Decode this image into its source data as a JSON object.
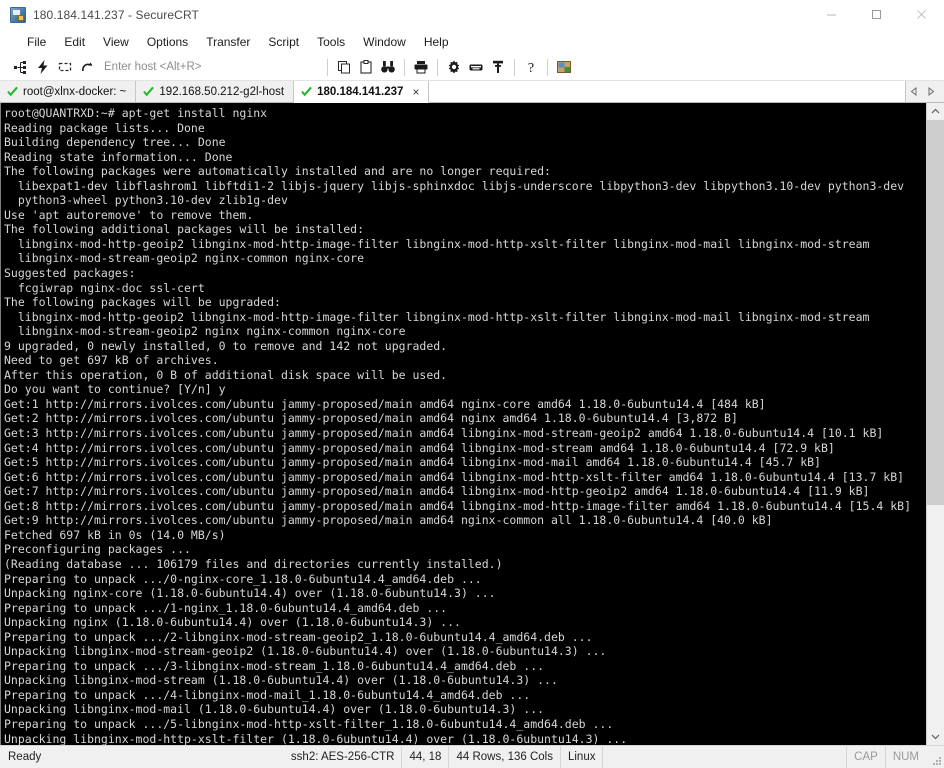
{
  "window": {
    "title": "180.184.141.237 - SecureCRT",
    "app_icon": "securecrt-icon",
    "minimize_label": "Minimize",
    "maximize_label": "Maximize",
    "close_label": "Close"
  },
  "menubar": {
    "items": [
      {
        "label": "File"
      },
      {
        "label": "Edit"
      },
      {
        "label": "View"
      },
      {
        "label": "Options"
      },
      {
        "label": "Transfer"
      },
      {
        "label": "Script"
      },
      {
        "label": "Tools"
      },
      {
        "label": "Window"
      },
      {
        "label": "Help"
      }
    ]
  },
  "toolbar": {
    "host_placeholder": "Enter host <Alt+R>",
    "host_value": "",
    "icons": [
      {
        "name": "new-session-icon",
        "title": "New Session"
      },
      {
        "name": "quick-connect-icon",
        "title": "Quick Connect"
      },
      {
        "name": "reconnect-icon",
        "title": "Reconnect"
      },
      {
        "name": "disconnect-icon",
        "title": "Disconnect"
      },
      {
        "name": "copy-icon",
        "title": "Copy"
      },
      {
        "name": "paste-icon",
        "title": "Paste"
      },
      {
        "name": "find-icon",
        "title": "Find"
      },
      {
        "name": "print-icon",
        "title": "Print"
      },
      {
        "name": "session-options-icon",
        "title": "Session Options"
      },
      {
        "name": "keymap-editor-icon",
        "title": "Keymap Editor"
      },
      {
        "name": "key-icon",
        "title": "Public Key"
      },
      {
        "name": "help-icon",
        "title": "Help"
      },
      {
        "name": "chat-window-icon",
        "title": "Chat Window"
      }
    ]
  },
  "tabs": {
    "items": [
      {
        "label": "root@xlnx-docker: ~",
        "active": false,
        "status": "connected"
      },
      {
        "label": "192.168.50.212-g2l-host",
        "active": false,
        "status": "connected"
      },
      {
        "label": "180.184.141.237",
        "active": true,
        "status": "connected"
      }
    ],
    "close_glyph": "×",
    "nav_prev": "◂",
    "nav_next": "▸"
  },
  "terminal": {
    "prompt": "root@QUANTRXD:~#",
    "command": "apt-get install nginx",
    "lines": [
      "root@QUANTRXD:~# apt-get install nginx",
      "Reading package lists... Done",
      "Building dependency tree... Done",
      "Reading state information... Done",
      "The following packages were automatically installed and are no longer required:",
      "  libexpat1-dev libflashrom1 libftdi1-2 libjs-jquery libjs-sphinxdoc libjs-underscore libpython3-dev libpython3.10-dev python3-dev",
      "  python3-wheel python3.10-dev zlib1g-dev",
      "Use 'apt autoremove' to remove them.",
      "The following additional packages will be installed:",
      "  libnginx-mod-http-geoip2 libnginx-mod-http-image-filter libnginx-mod-http-xslt-filter libnginx-mod-mail libnginx-mod-stream",
      "  libnginx-mod-stream-geoip2 nginx-common nginx-core",
      "Suggested packages:",
      "  fcgiwrap nginx-doc ssl-cert",
      "The following packages will be upgraded:",
      "  libnginx-mod-http-geoip2 libnginx-mod-http-image-filter libnginx-mod-http-xslt-filter libnginx-mod-mail libnginx-mod-stream",
      "  libnginx-mod-stream-geoip2 nginx nginx-common nginx-core",
      "9 upgraded, 0 newly installed, 0 to remove and 142 not upgraded.",
      "Need to get 697 kB of archives.",
      "After this operation, 0 B of additional disk space will be used.",
      "Do you want to continue? [Y/n] y",
      "Get:1 http://mirrors.ivolces.com/ubuntu jammy-proposed/main amd64 nginx-core amd64 1.18.0-6ubuntu14.4 [484 kB]",
      "Get:2 http://mirrors.ivolces.com/ubuntu jammy-proposed/main amd64 nginx amd64 1.18.0-6ubuntu14.4 [3,872 B]",
      "Get:3 http://mirrors.ivolces.com/ubuntu jammy-proposed/main amd64 libnginx-mod-stream-geoip2 amd64 1.18.0-6ubuntu14.4 [10.1 kB]",
      "Get:4 http://mirrors.ivolces.com/ubuntu jammy-proposed/main amd64 libnginx-mod-stream amd64 1.18.0-6ubuntu14.4 [72.9 kB]",
      "Get:5 http://mirrors.ivolces.com/ubuntu jammy-proposed/main amd64 libnginx-mod-mail amd64 1.18.0-6ubuntu14.4 [45.7 kB]",
      "Get:6 http://mirrors.ivolces.com/ubuntu jammy-proposed/main amd64 libnginx-mod-http-xslt-filter amd64 1.18.0-6ubuntu14.4 [13.7 kB]",
      "Get:7 http://mirrors.ivolces.com/ubuntu jammy-proposed/main amd64 libnginx-mod-http-geoip2 amd64 1.18.0-6ubuntu14.4 [11.9 kB]",
      "Get:8 http://mirrors.ivolces.com/ubuntu jammy-proposed/main amd64 libnginx-mod-http-image-filter amd64 1.18.0-6ubuntu14.4 [15.4 kB]",
      "Get:9 http://mirrors.ivolces.com/ubuntu jammy-proposed/main amd64 nginx-common all 1.18.0-6ubuntu14.4 [40.0 kB]",
      "Fetched 697 kB in 0s (14.0 MB/s)",
      "Preconfiguring packages ...",
      "(Reading database ... 106179 files and directories currently installed.)",
      "Preparing to unpack .../0-nginx-core_1.18.0-6ubuntu14.4_amd64.deb ...",
      "Unpacking nginx-core (1.18.0-6ubuntu14.4) over (1.18.0-6ubuntu14.3) ...",
      "Preparing to unpack .../1-nginx_1.18.0-6ubuntu14.4_amd64.deb ...",
      "Unpacking nginx (1.18.0-6ubuntu14.4) over (1.18.0-6ubuntu14.3) ...",
      "Preparing to unpack .../2-libnginx-mod-stream-geoip2_1.18.0-6ubuntu14.4_amd64.deb ...",
      "Unpacking libnginx-mod-stream-geoip2 (1.18.0-6ubuntu14.4) over (1.18.0-6ubuntu14.3) ...",
      "Preparing to unpack .../3-libnginx-mod-stream_1.18.0-6ubuntu14.4_amd64.deb ...",
      "Unpacking libnginx-mod-stream (1.18.0-6ubuntu14.4) over (1.18.0-6ubuntu14.3) ...",
      "Preparing to unpack .../4-libnginx-mod-mail_1.18.0-6ubuntu14.4_amd64.deb ...",
      "Unpacking libnginx-mod-mail (1.18.0-6ubuntu14.4) over (1.18.0-6ubuntu14.3) ...",
      "Preparing to unpack .../5-libnginx-mod-http-xslt-filter_1.18.0-6ubuntu14.4_amd64.deb ...",
      "Unpacking libnginx-mod-http-xslt-filter (1.18.0-6ubuntu14.4) over (1.18.0-6ubuntu14.3) ..."
    ],
    "background": "#000000",
    "foreground": "#d6d6d6"
  },
  "scrollbar": {
    "up_glyph": "∧",
    "down_glyph": "∨"
  },
  "statusbar": {
    "ready": "Ready",
    "encryption": "ssh2: AES-256-CTR",
    "cursor": "44, 18",
    "size": "44 Rows, 136 Cols",
    "emulation": "Linux",
    "cap": "CAP",
    "num": "NUM"
  },
  "colors": {
    "accent_green": "#2db92d",
    "terminal_bg": "#000000",
    "terminal_fg": "#d6d6d6",
    "chrome_bg": "#f0f0f0"
  }
}
